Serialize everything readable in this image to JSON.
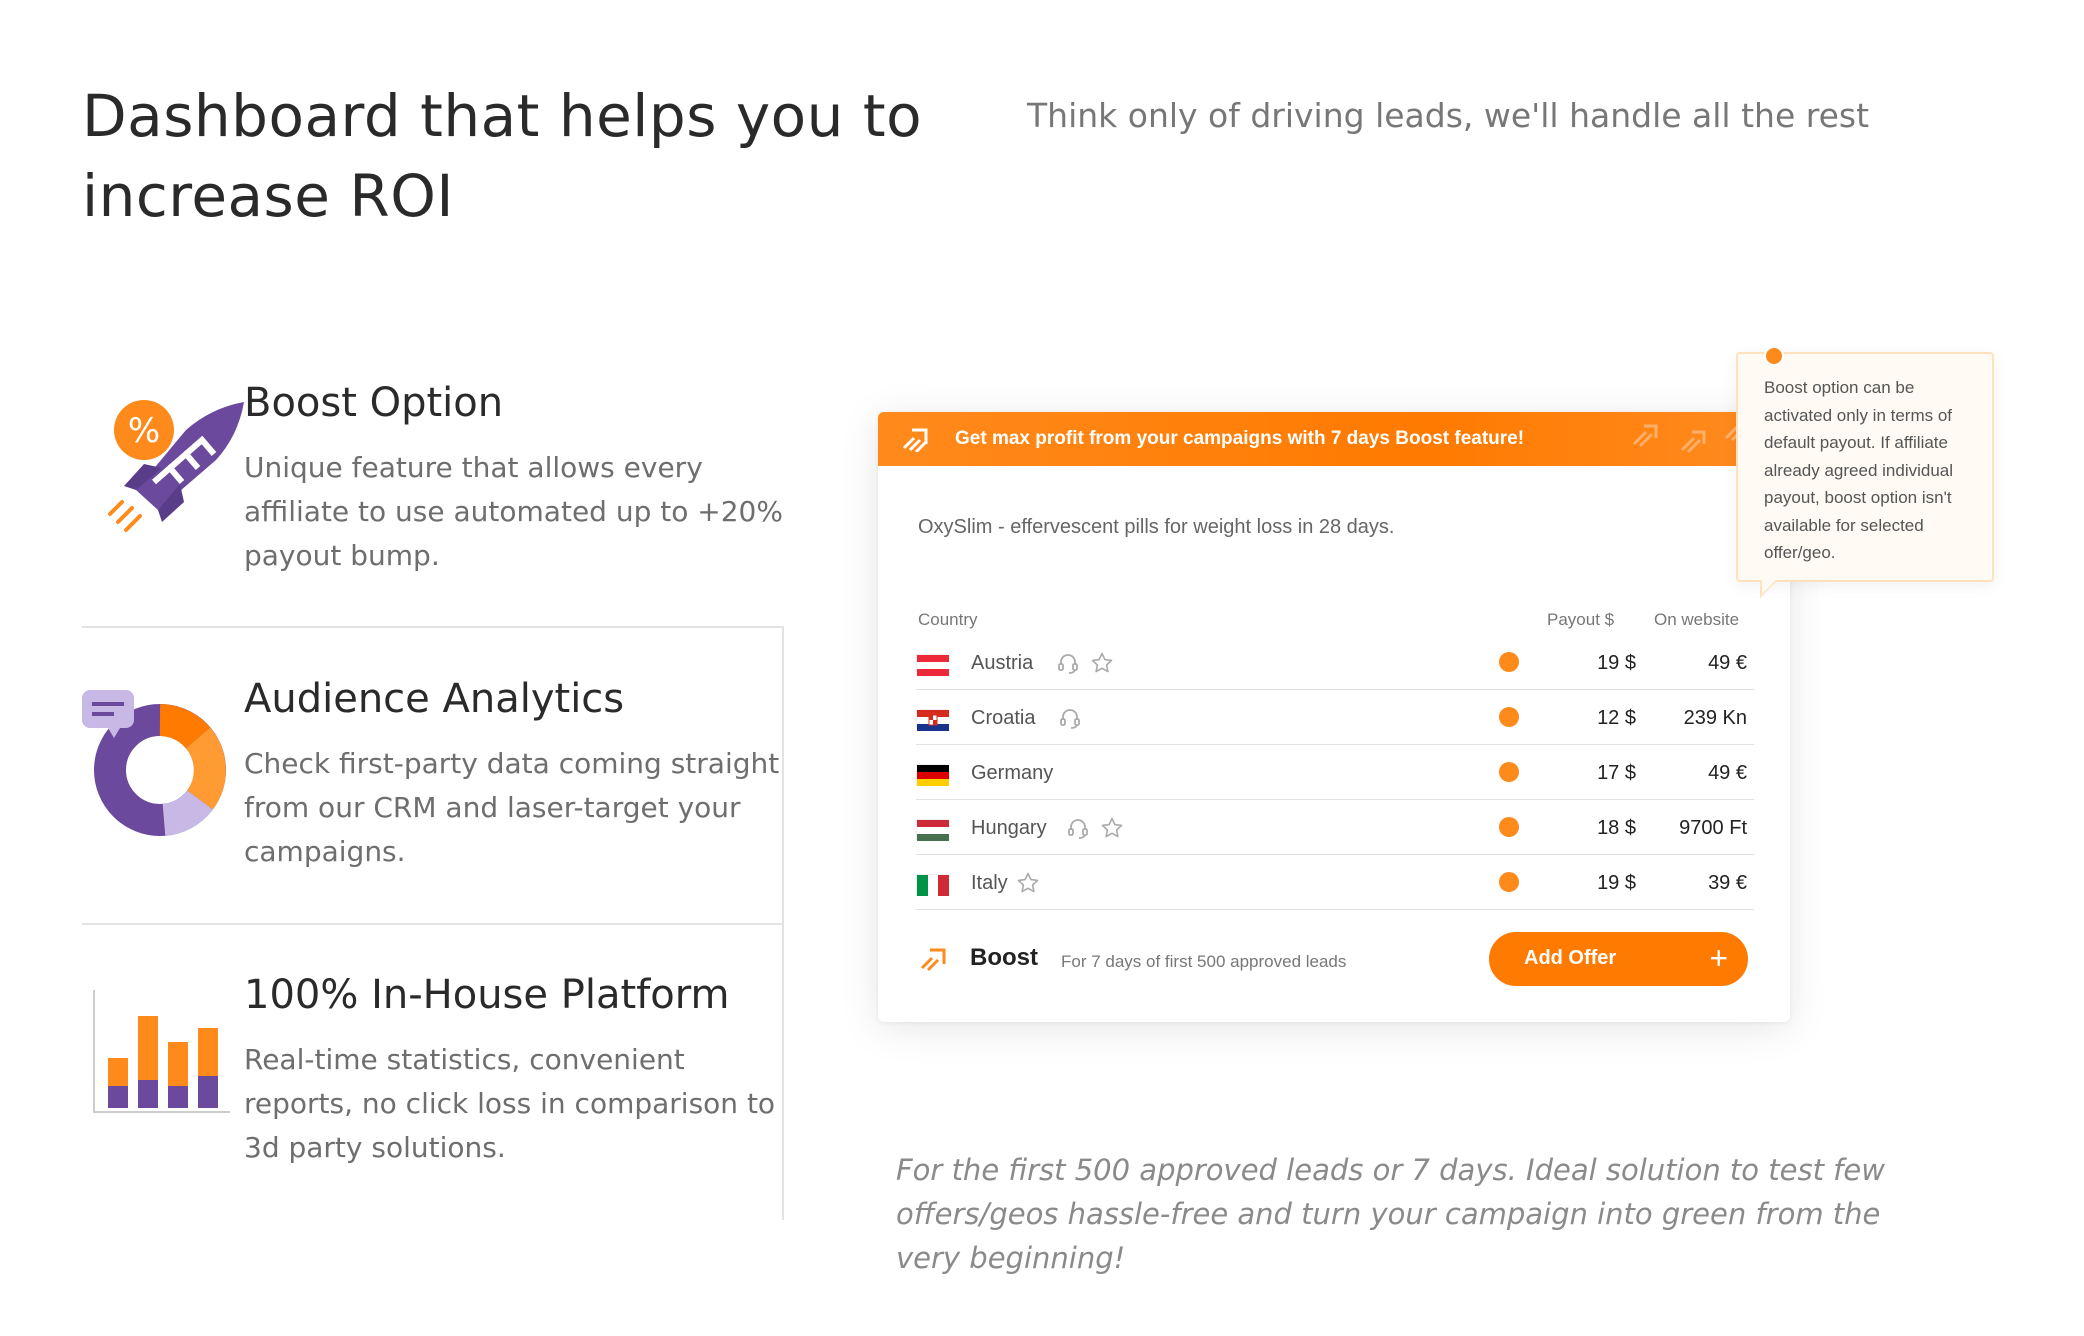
{
  "hero": {
    "title": "Dashboard that helps you to increase ROI",
    "subtitle": "Think only of driving leads, we'll handle all the rest"
  },
  "features": [
    {
      "icon": "rocket-percent-icon",
      "title": "Boost Option",
      "description": "Unique feature that allows every affiliate to use automated up to +20% payout bump."
    },
    {
      "icon": "donut-chart-icon",
      "title": "Audience Analytics",
      "description": "Check first-party data coming straight from our CRM and laser-target your campaigns."
    },
    {
      "icon": "bar-chart-icon",
      "title": "100% In-House Platform",
      "description": "Real-time statistics, convenient reports, no click loss in comparison to 3d party solutions."
    }
  ],
  "card": {
    "banner_text": "Get max profit from your campaigns with 7 days Boost feature!",
    "product": "OxySlim - effervescent pills for weight loss in 28 days.",
    "headers": {
      "country": "Country",
      "payout": "Payout $",
      "on_website": "On website"
    },
    "rows": [
      {
        "country": "Austria",
        "flag": "austria-flag",
        "support_icon": true,
        "star_icon": true,
        "payout": "19 $",
        "on_website": "49 €"
      },
      {
        "country": "Croatia",
        "flag": "croatia-flag",
        "support_icon": true,
        "star_icon": false,
        "payout": "12 $",
        "on_website": "239 Kn"
      },
      {
        "country": "Germany",
        "flag": "germany-flag",
        "support_icon": false,
        "star_icon": false,
        "payout": "17 $",
        "on_website": "49 €"
      },
      {
        "country": "Hungary",
        "flag": "hungary-flag",
        "support_icon": true,
        "star_icon": true,
        "payout": "18 $",
        "on_website": "9700 Ft"
      },
      {
        "country": "Italy",
        "flag": "italy-flag",
        "support_icon": false,
        "star_icon": true,
        "payout": "19 $",
        "on_website": "39 €"
      }
    ],
    "boost_label": "Boost",
    "boost_note": "For 7 days of first 500 approved leads",
    "add_offer_label": "Add Offer",
    "add_offer_icon": "+"
  },
  "tooltip": {
    "text": "Boost option can be activated only in terms of default payout. If affiliate already agreed individual payout, boost option isn't available for selected offer/geo."
  },
  "bottom_note": "For the first 500 approved leads or 7 days. Ideal solution to test few offers/geos hassle-free and turn your campaign into green from the very beginning!",
  "colors": {
    "accent": "#ff7a00",
    "purple": "#6b4a9e",
    "lavender": "#c8b8e6"
  }
}
